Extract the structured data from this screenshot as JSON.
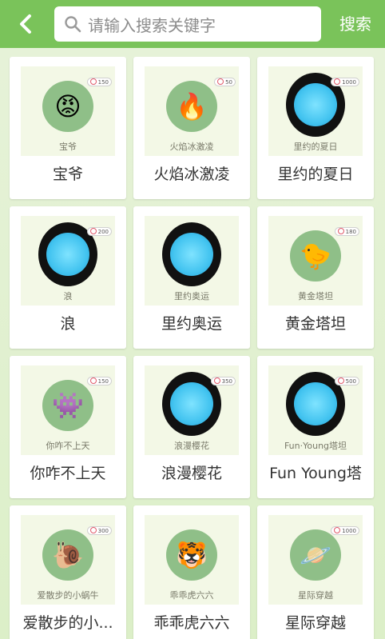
{
  "header": {
    "back_icon": "chevron-left-icon",
    "search_placeholder": "请输入搜索关键字",
    "search_icon": "search-icon",
    "search_label": "搜索"
  },
  "colors": {
    "header_bg": "#7ac35a",
    "page_bg": "#dcefc8",
    "card_bg": "#ffffff"
  },
  "items": [
    {
      "name": "宝爷",
      "caption": "宝爷",
      "price": "150",
      "style": "face",
      "glyph": "😡"
    },
    {
      "name": "火焰冰激凌",
      "caption": "火焰冰激凌",
      "price": "50",
      "style": "face",
      "glyph": "🔥"
    },
    {
      "name": "里约的夏日",
      "caption": "里约的夏日",
      "price": "1000",
      "style": "dark",
      "glyph": ""
    },
    {
      "name": "浪",
      "caption": "浪",
      "price": "200",
      "style": "dark",
      "glyph": ""
    },
    {
      "name": "里约奥运",
      "caption": "里约奥运",
      "price": "",
      "style": "dark",
      "glyph": ""
    },
    {
      "name": "黄金塔坦",
      "caption": "黄金塔坦",
      "price": "180",
      "style": "face",
      "glyph": "🐤"
    },
    {
      "name": "你咋不上天",
      "caption": "你咋不上天",
      "price": "150",
      "style": "face",
      "glyph": "👾"
    },
    {
      "name": "浪漫樱花",
      "caption": "浪漫樱花",
      "price": "350",
      "style": "dark",
      "glyph": ""
    },
    {
      "name": "Fun Young塔",
      "caption": "Fun·Young塔坦",
      "price": "500",
      "style": "dark",
      "glyph": ""
    },
    {
      "name": "爱散步的小...",
      "caption": "爱散步的小蜗牛",
      "price": "300",
      "style": "face",
      "glyph": "🐌"
    },
    {
      "name": "乖乖虎六六",
      "caption": "乖乖虎六六",
      "price": "",
      "style": "face",
      "glyph": "🐯"
    },
    {
      "name": "星际穿越",
      "caption": "星际穿越",
      "price": "1000",
      "style": "face",
      "glyph": "🪐"
    }
  ]
}
